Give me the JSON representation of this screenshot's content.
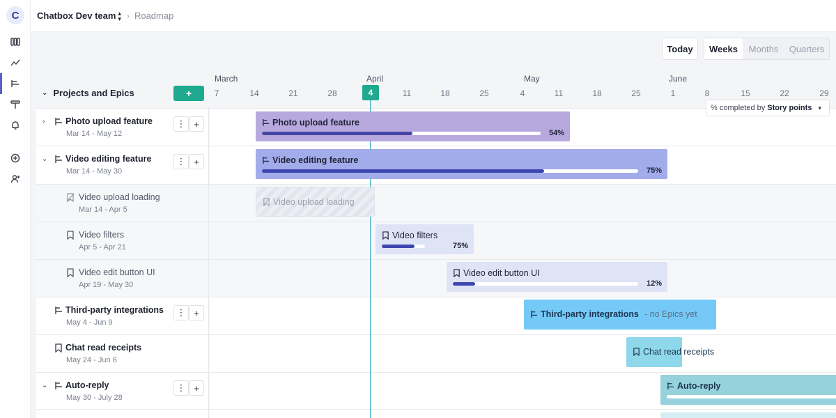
{
  "app": {
    "logo_letter": "C",
    "team": "Chatbox Dev team",
    "breadcrumb": "Roadmap"
  },
  "toolbar": {
    "today": "Today",
    "views": [
      "Weeks",
      "Months",
      "Quarters"
    ],
    "active_view": "Weeks"
  },
  "list": {
    "title": "Projects and Epics",
    "add_label": "+"
  },
  "timeline": {
    "months": [
      "March",
      "April",
      "May",
      "June"
    ],
    "days": [
      "7",
      "14",
      "21",
      "28",
      "4",
      "11",
      "18",
      "25",
      "4",
      "11",
      "18",
      "25",
      "1",
      "8",
      "15",
      "22",
      "29"
    ],
    "today_day": "4",
    "metric_prefix": "% completed by",
    "metric_value": "Story points"
  },
  "rows": [
    {
      "title": "Photo upload feature",
      "dates": "Mar 14 - May 12",
      "type": "project",
      "expanded": false,
      "actions": true,
      "progress": 54,
      "progress_label": "54%"
    },
    {
      "title": "Video editing feature",
      "dates": "Mar 14 - May 30",
      "type": "project",
      "expanded": true,
      "actions": true,
      "progress": 75,
      "progress_label": "75%"
    },
    {
      "title": "Video upload loading",
      "dates": "Mar 14 - Apr 5",
      "type": "epic-done",
      "sub": true
    },
    {
      "title": "Video filters",
      "dates": "Apr 5 - Apr 21",
      "type": "epic",
      "sub": true,
      "progress": 75,
      "progress_label": "75%"
    },
    {
      "title": "Video edit button UI",
      "dates": "Apr 19 - May 30",
      "type": "epic",
      "sub": true,
      "progress": 12,
      "progress_label": "12%"
    },
    {
      "title": "Third-party integrations",
      "dates": "May 4 - Jun 9",
      "type": "project",
      "actions": true,
      "note": "- no Epics yet"
    },
    {
      "title": "Chat read receipts",
      "dates": "May 24 - Jun 6",
      "type": "epic"
    },
    {
      "title": "Auto-reply",
      "dates": "May 30 - July 28",
      "type": "project",
      "expanded": true,
      "actions": true
    }
  ],
  "colors": {
    "accent": "#1faa8f",
    "purple_bar": "#b7a9dd",
    "indigo_bar": "#a3acea",
    "lavender_bar": "#dfe3f6",
    "sky_bar": "#74c9f7",
    "cyan_bar": "#8fd7ea",
    "teal_bar": "#96d2dc"
  }
}
